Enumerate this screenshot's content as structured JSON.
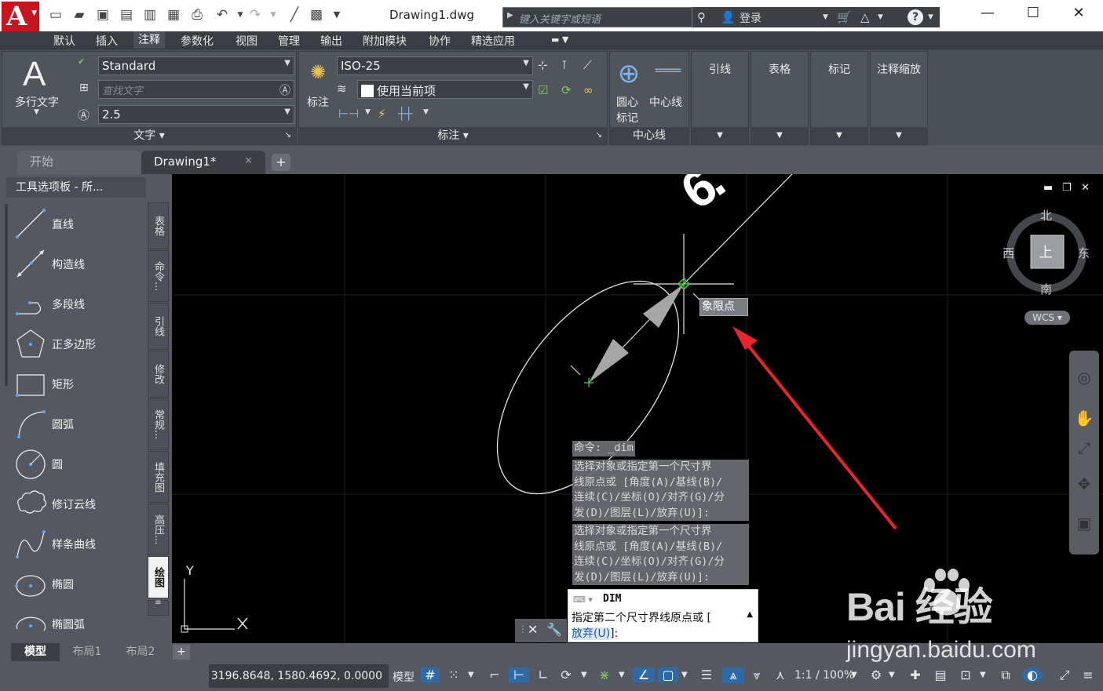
{
  "titlebar": {
    "doc_title": "Drawing1.dwg",
    "search_placeholder": "键入关键字或短语",
    "login": "登录"
  },
  "menu": [
    "默认",
    "插入",
    "注释",
    "参数化",
    "视图",
    "管理",
    "输出",
    "附加模块",
    "协作",
    "精选应用"
  ],
  "menu_active_index": 2,
  "ribbon": {
    "text_panel": {
      "mtext_label": "多行文字",
      "text_style": "Standard",
      "find_placeholder": "查找文字",
      "text_height": "2.5",
      "title": "文字"
    },
    "dim_panel": {
      "dim_label": "标注",
      "dim_style": "ISO-25",
      "layer": "使用当前项",
      "title": "标注"
    },
    "center_panel": {
      "center_mark_line1": "圆心",
      "center_mark_line2": "标记",
      "centerline": "中心线",
      "title": "中心线"
    },
    "other_panels": [
      "引线",
      "表格",
      "标记",
      "注释缩放"
    ]
  },
  "doc_tabs": {
    "start": "开始",
    "drawing": "Drawing1*"
  },
  "palette": {
    "header": "工具选项板 - 所...",
    "items": [
      "直线",
      "构造线",
      "多段线",
      "正多边形",
      "矩形",
      "圆弧",
      "圆",
      "修订云线",
      "样条曲线",
      "椭圆",
      "椭圆弧"
    ],
    "side_tabs": [
      "表格",
      "命令...",
      "引线",
      "修改",
      "常规...",
      "填充图",
      "高压...",
      "绘图"
    ],
    "active_side_tab": "绘图"
  },
  "canvas": {
    "dim_text": "6.",
    "osnap_tooltip": "象限点",
    "ucs_y": "Y",
    "command_history": [
      "命令: _dim",
      "选择对象或指定第一个尺寸界",
      "线原点或 [角度(A)/基线(B)/",
      "连续(C)/坐标(O)/对齐(G)/分",
      "发(D)/图层(L)/放弃(U)]:",
      "选择对象或指定第一个尺寸界",
      "线原点或 [角度(A)/基线(B)/",
      "连续(C)/坐标(O)/对齐(G)/分",
      "发(D)/图层(L)/放弃(U)]:"
    ],
    "command_input": {
      "name": "DIM",
      "prompt": "指定第二个尺寸界线原点或 [",
      "option": "放弃(U)",
      "tail": "]:"
    }
  },
  "viewcube": {
    "north": "北",
    "south": "南",
    "east": "东",
    "west": "西",
    "face": "上",
    "wcs": "WCS"
  },
  "layout_tabs": [
    "模型",
    "布局1",
    "布局2"
  ],
  "status": {
    "coords": "3196.8648, 1580.4692, 0.0000",
    "model": "模型",
    "scale": "1:1 / 100%"
  },
  "watermark": {
    "brand": "Bai  经验",
    "url": "jingyan.baidu.com"
  },
  "colors": {
    "accent_red": "#e8252b",
    "snap_green": "#3adf3a",
    "status_on": "#2e6aa8"
  }
}
